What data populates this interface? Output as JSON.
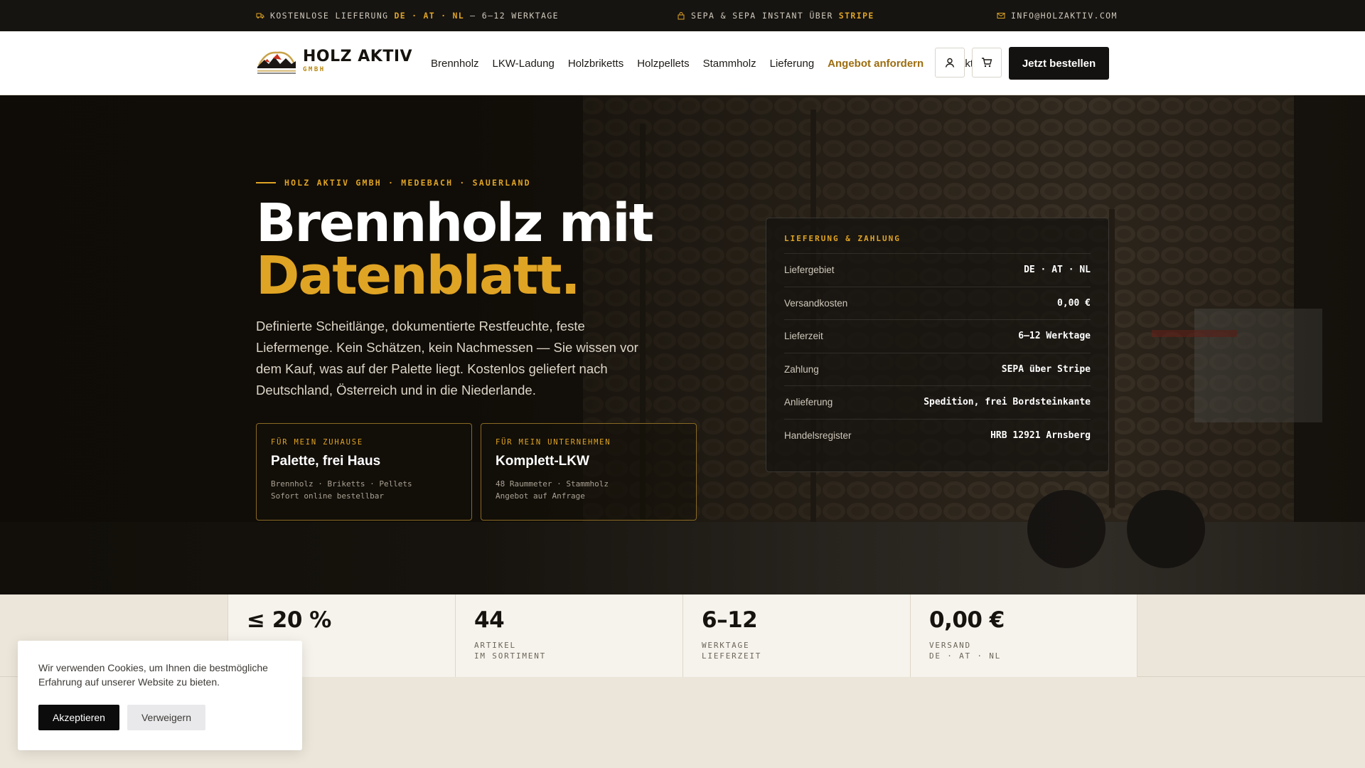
{
  "topbar": {
    "delivery": {
      "prefix": "KOSTENLOSE LIEFERUNG",
      "countries": [
        "DE",
        "AT",
        "NL"
      ],
      "dot": "·",
      "suffix": "— 6–12 WERKTAGE"
    },
    "payment": {
      "prefix": "SEPA & SEPA INSTANT ÜBER",
      "brand": "STRIPE"
    },
    "email": "INFO@HOLZAKTIV.COM"
  },
  "header": {
    "logo_name": "HOLZ AKTIV",
    "logo_sub": "GMBH",
    "nav": [
      "Brennholz",
      "LKW-Ladung",
      "Holzbriketts",
      "Holzpellets",
      "Stammholz",
      "Lieferung",
      "Angebot anfordern",
      "Kontakt"
    ],
    "order_label": "Jetzt bestellen"
  },
  "hero": {
    "eyebrow": "HOLZ AKTIV GMBH · MEDEBACH · SAUERLAND",
    "title_line1": "Brennholz mit",
    "title_line2": "Datenblatt.",
    "lead": "Definierte Scheitlänge, dokumentierte Restfeuchte, feste Liefermenge. Kein Schätzen, kein Nachmessen — Sie wissen vor dem Kauf, was auf der Palette liegt. Kostenlos geliefert nach Deutschland, Österreich und in die Niederlande.",
    "cards": [
      {
        "kicker": "FÜR MEIN ZUHAUSE",
        "title": "Palette, frei Haus",
        "line1": "Brennholz · Briketts · Pellets",
        "line2": "Sofort online bestellbar"
      },
      {
        "kicker": "FÜR MEIN UNTERNEHMEN",
        "title": "Komplett-LKW",
        "line1": "48 Raummeter · Stammholz",
        "line2": "Angebot auf Anfrage"
      }
    ],
    "panel": {
      "heading": "LIEFERUNG & ZAHLUNG",
      "rows": [
        {
          "label": "Liefergebiet",
          "value": "DE · AT · NL"
        },
        {
          "label": "Versandkosten",
          "value": "0,00 €"
        },
        {
          "label": "Lieferzeit",
          "value": "6–12 Werktage"
        },
        {
          "label": "Zahlung",
          "value": "SEPA über Stripe"
        },
        {
          "label": "Anlieferung",
          "value": "Spedition, frei Bordsteinkante"
        },
        {
          "label": "Handelsregister",
          "value": "HRB 12921 Arnsberg"
        }
      ]
    }
  },
  "stats": [
    {
      "value": "≤ 20 %",
      "label": ""
    },
    {
      "value": "44",
      "label": "ARTIKEL\nIM SORTIMENT"
    },
    {
      "value": "6–12",
      "label": "WERKTAGE\nLIEFERZEIT"
    },
    {
      "value": "0,00 €",
      "label": "VERSAND\nDE · AT · NL"
    }
  ],
  "cookie": {
    "message": "Wir verwenden Cookies, um Ihnen die bestmögliche Erfahrung auf unserer Website zu bieten.",
    "accept": "Akzeptieren",
    "deny": "Verweigern"
  },
  "colors": {
    "accent": "#e0a424",
    "dark": "#161411",
    "cream": "#ece6da"
  }
}
